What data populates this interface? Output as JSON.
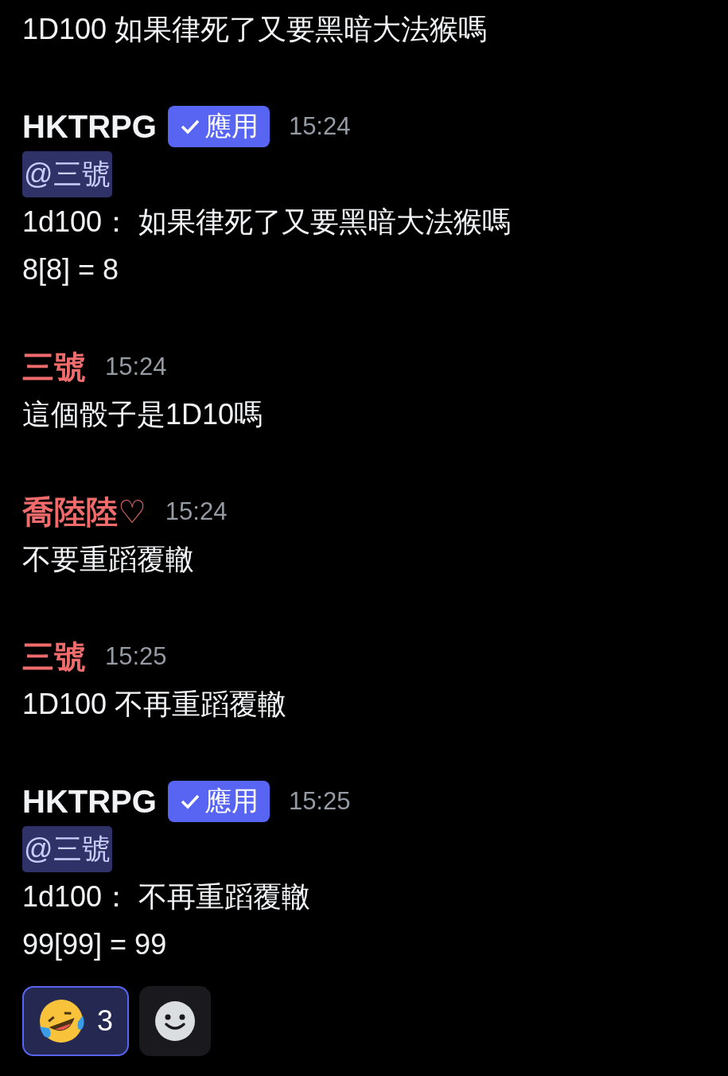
{
  "messages": [
    {
      "kind": "continuation",
      "lines": [
        {
          "kind": "text",
          "text": "1D100 如果律死了又要黑暗大法猴嗎"
        }
      ]
    },
    {
      "kind": "message",
      "author": "HKTRPG",
      "color": "#f2f3f5",
      "badge": "應用",
      "time": "15:24",
      "lines": [
        {
          "kind": "mention",
          "text": "@三號"
        },
        {
          "kind": "text",
          "text": "1d100： 如果律死了又要黑暗大法猴嗎"
        },
        {
          "kind": "text",
          "text": "8[8] = 8"
        }
      ]
    },
    {
      "kind": "message",
      "author": "三號",
      "color": "#f06b6b",
      "time": "15:24",
      "lines": [
        {
          "kind": "text",
          "text": "這個骰子是1D10嗎"
        }
      ]
    },
    {
      "kind": "message",
      "author": "喬陸陸♡",
      "color": "#f06b6b",
      "time": "15:24",
      "lines": [
        {
          "kind": "text",
          "text": "不要重蹈覆轍"
        }
      ]
    },
    {
      "kind": "message",
      "author": "三號",
      "color": "#f06b6b",
      "time": "15:25",
      "lines": [
        {
          "kind": "text",
          "text": "1D100 不再重蹈覆轍"
        }
      ]
    },
    {
      "kind": "message",
      "author": "HKTRPG",
      "color": "#f2f3f5",
      "badge": "應用",
      "time": "15:25",
      "lines": [
        {
          "kind": "mention",
          "text": "@三號"
        },
        {
          "kind": "text",
          "text": "1d100： 不再重蹈覆轍"
        },
        {
          "kind": "text",
          "text": "99[99] = 99"
        }
      ]
    }
  ],
  "reactions": [
    {
      "count": "3",
      "selected": true
    }
  ]
}
